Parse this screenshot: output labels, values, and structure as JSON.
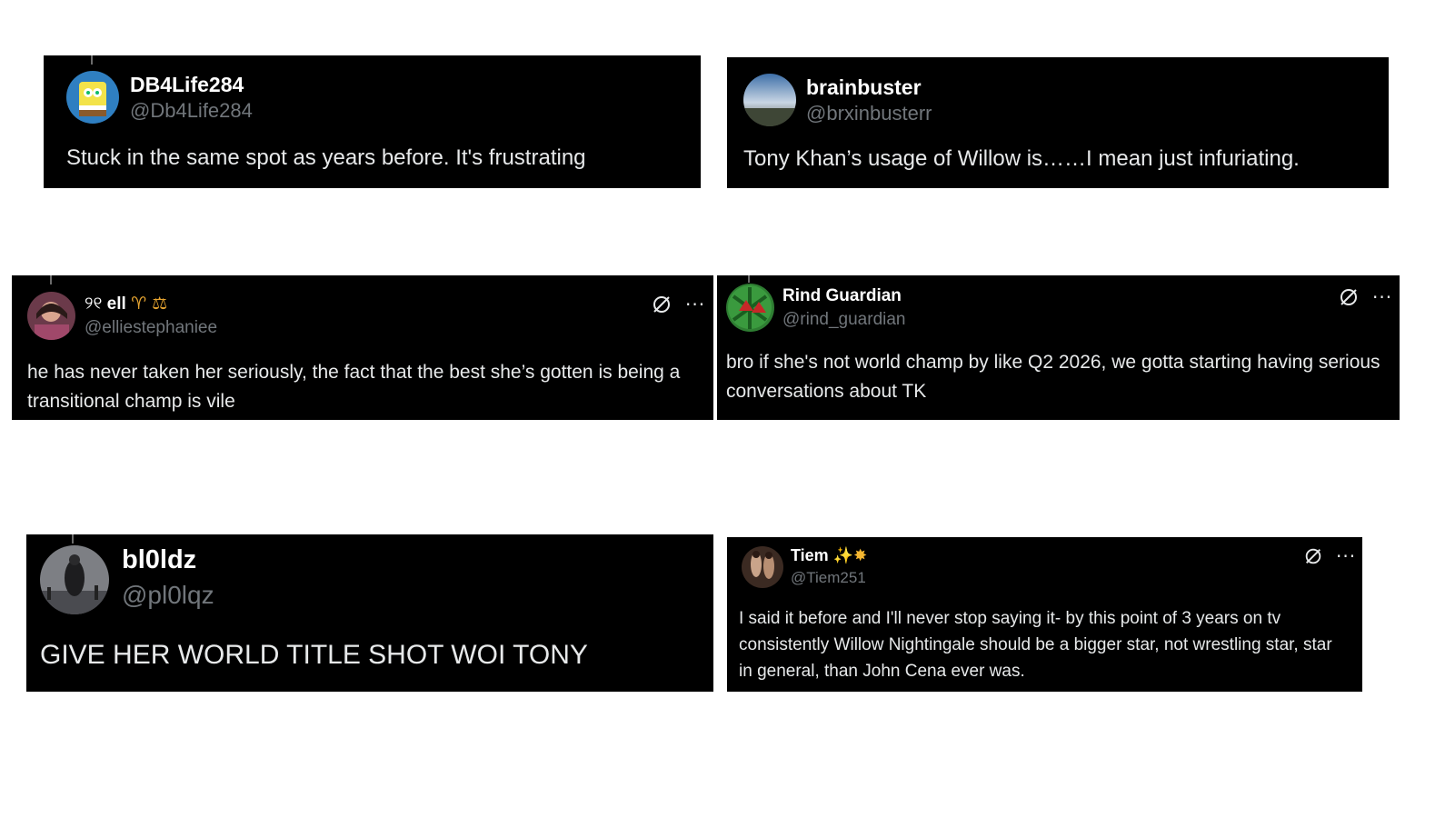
{
  "tweets": [
    {
      "display_name": "DB4Life284",
      "handle": "@Db4Life284",
      "text": "Stuck in the same spot as years before. It's frustrating"
    },
    {
      "display_name": "brainbuster",
      "handle": "@brxinbusterr",
      "text": "Tony Khan’s usage of Willow is……I mean just infuriating."
    },
    {
      "display_name": "ell",
      "name_prefix": "୨୧",
      "name_suffix": "♈ ⚖",
      "handle": "@elliestephaniee",
      "text": "he has never taken her seriously, the fact that the best she’s gotten is being a transitional champ is vile"
    },
    {
      "display_name": "Rind Guardian",
      "handle": "@rind_guardian",
      "text": "bro if she's not world champ by like Q2 2026, we gotta starting having serious conversations about TK"
    },
    {
      "display_name": "bl0ldz",
      "handle": "@pl0lqz",
      "text": "GIVE HER WORLD TITLE SHOT WOI TONY"
    },
    {
      "display_name": "Tiem",
      "name_suffix": "✨✸",
      "handle": "@Tiem251",
      "text": "I said it before and I'll never stop saying it- by this point of 3 years on tv consistently Willow Nightingale should be a bigger star, not wrestling star, star in general, than John Cena ever was."
    }
  ],
  "icons": {
    "grok": "grok-icon",
    "more": "more-icon",
    "more_glyph": "···"
  },
  "colors": {
    "card_bg": "#000000",
    "name": "#ffffff",
    "handle": "#71767b",
    "text": "#e7e9ea",
    "page_bg": "#ffffff"
  }
}
